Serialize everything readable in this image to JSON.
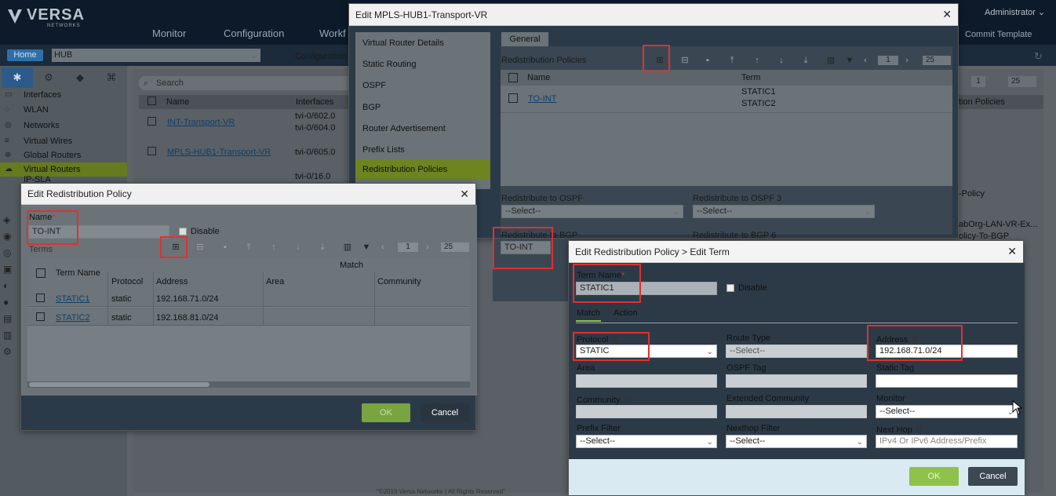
{
  "app": {
    "logo": "VERSA",
    "logo_sub": "NETWORKS",
    "nav": [
      "Monitor",
      "Configuration",
      "Workf"
    ],
    "user": "Administrator",
    "commit": "Commit Template",
    "home": "Home",
    "org": "HUB",
    "config_tab": "Configuration",
    "footer": "\"©2019 Versa Networks | All Rights Reserved\""
  },
  "sidebar": {
    "tabs": [
      "network-icon",
      "gear-icon",
      "cube-icon",
      "lan-icon"
    ],
    "items": [
      {
        "label": "Interfaces"
      },
      {
        "label": "WLAN"
      },
      {
        "label": "Networks"
      },
      {
        "label": "Virtual Wires"
      },
      {
        "label": "Global Routers"
      },
      {
        "label": "Virtual Routers"
      },
      {
        "label": "IP-SLA"
      }
    ]
  },
  "bgtable": {
    "search_placeholder": "Search",
    "col_name": "Name",
    "col_interfaces": "Interfaces",
    "col_policies": "tion Policies",
    "page": "1",
    "page_size": "25",
    "rows": [
      {
        "name": "INT-Transport-VR",
        "if1": "tvi-0/602.0",
        "if2": "tvi-0/604.0"
      },
      {
        "name": "MPLS-HUB1-Transport-VR",
        "if1": "tvi-0/605.0",
        "if2": ""
      },
      {
        "name": "",
        "if1": "tvi-0/16.0",
        "if2": ""
      }
    ],
    "policy_a": "-Policy",
    "policy_b1": "abOrg-LAN-VR-Ex...",
    "policy_b2": "olicy-To-BGP"
  },
  "vr_modal": {
    "title": "Edit MPLS-HUB1-Transport-VR",
    "menu": [
      "Virtual Router Details",
      "Static Routing",
      "OSPF",
      "BGP",
      "Router Advertisement",
      "Prefix Lists",
      "Redistribution Policies"
    ],
    "tab": "General",
    "section": "Redistribution Policies",
    "page": "1",
    "page_size": "25",
    "col_name": "Name",
    "col_term": "Term",
    "row_name": "TO-INT",
    "row_term1": "STATIC1",
    "row_term2": "STATIC2",
    "ospf_label": "Redistribute to OSPF",
    "ospf_value": "--Select--",
    "ospf3_label": "Redistribute to OSPF 3",
    "ospf3_value": "--Select--",
    "bgp_label": "Redistribute to BGP",
    "bgp_value": "TO-INT",
    "bgp6_label": "Redistribute to BGP 6"
  },
  "policy_modal": {
    "title": "Edit Redistribution Policy",
    "name_label": "Name",
    "required": "*",
    "name_value": "TO-INT",
    "disable": "Disable",
    "terms": "Terms",
    "page": "1",
    "page_size": "25",
    "col_term": "Term Name",
    "col_match": "Match",
    "col_protocol": "Protocol",
    "col_address": "Address",
    "col_area": "Area",
    "col_community": "Community",
    "rows": [
      {
        "term": "STATIC1",
        "protocol": "static",
        "address": "192.168.71.0/24"
      },
      {
        "term": "STATIC2",
        "protocol": "static",
        "address": "192.168.81.0/24"
      }
    ],
    "ok": "OK",
    "cancel": "Cancel"
  },
  "term_modal": {
    "title": "Edit Redistribution Policy > Edit Term",
    "term_label": "Term Name",
    "required": "*",
    "term_value": "STATIC1",
    "disable": "Disable",
    "tab_match": "Match",
    "tab_action": "Action",
    "protocol_label": "Protocol",
    "protocol_value": "STATIC",
    "route_type_label": "Route Type",
    "route_type_value": "--Select--",
    "address_label": "Address",
    "address_value": "192.168.71.0/24",
    "area_label": "Area",
    "ospf_tag_label": "OSPF Tag",
    "static_tag_label": "Static Tag",
    "community_label": "Community",
    "ext_community_label": "Extended Community",
    "monitor_label": "Monitor",
    "monitor_value": "--Select--",
    "prefix_filter_label": "Prefix Filter",
    "prefix_filter_value": "--Select--",
    "nexthop_filter_label": "Nexthop Filter",
    "nexthop_filter_value": "--Select--",
    "next_hop_label": "Next Hop",
    "next_hop_placeholder": "IPv4 Or IPv6 Address/Prefix",
    "ok": "OK",
    "cancel": "Cancel"
  },
  "colors": {
    "accent_green": "#8fc24a",
    "highlight_red": "#e03030",
    "link_blue": "#0e5a9a",
    "header_navy": "#0d1a2a"
  }
}
